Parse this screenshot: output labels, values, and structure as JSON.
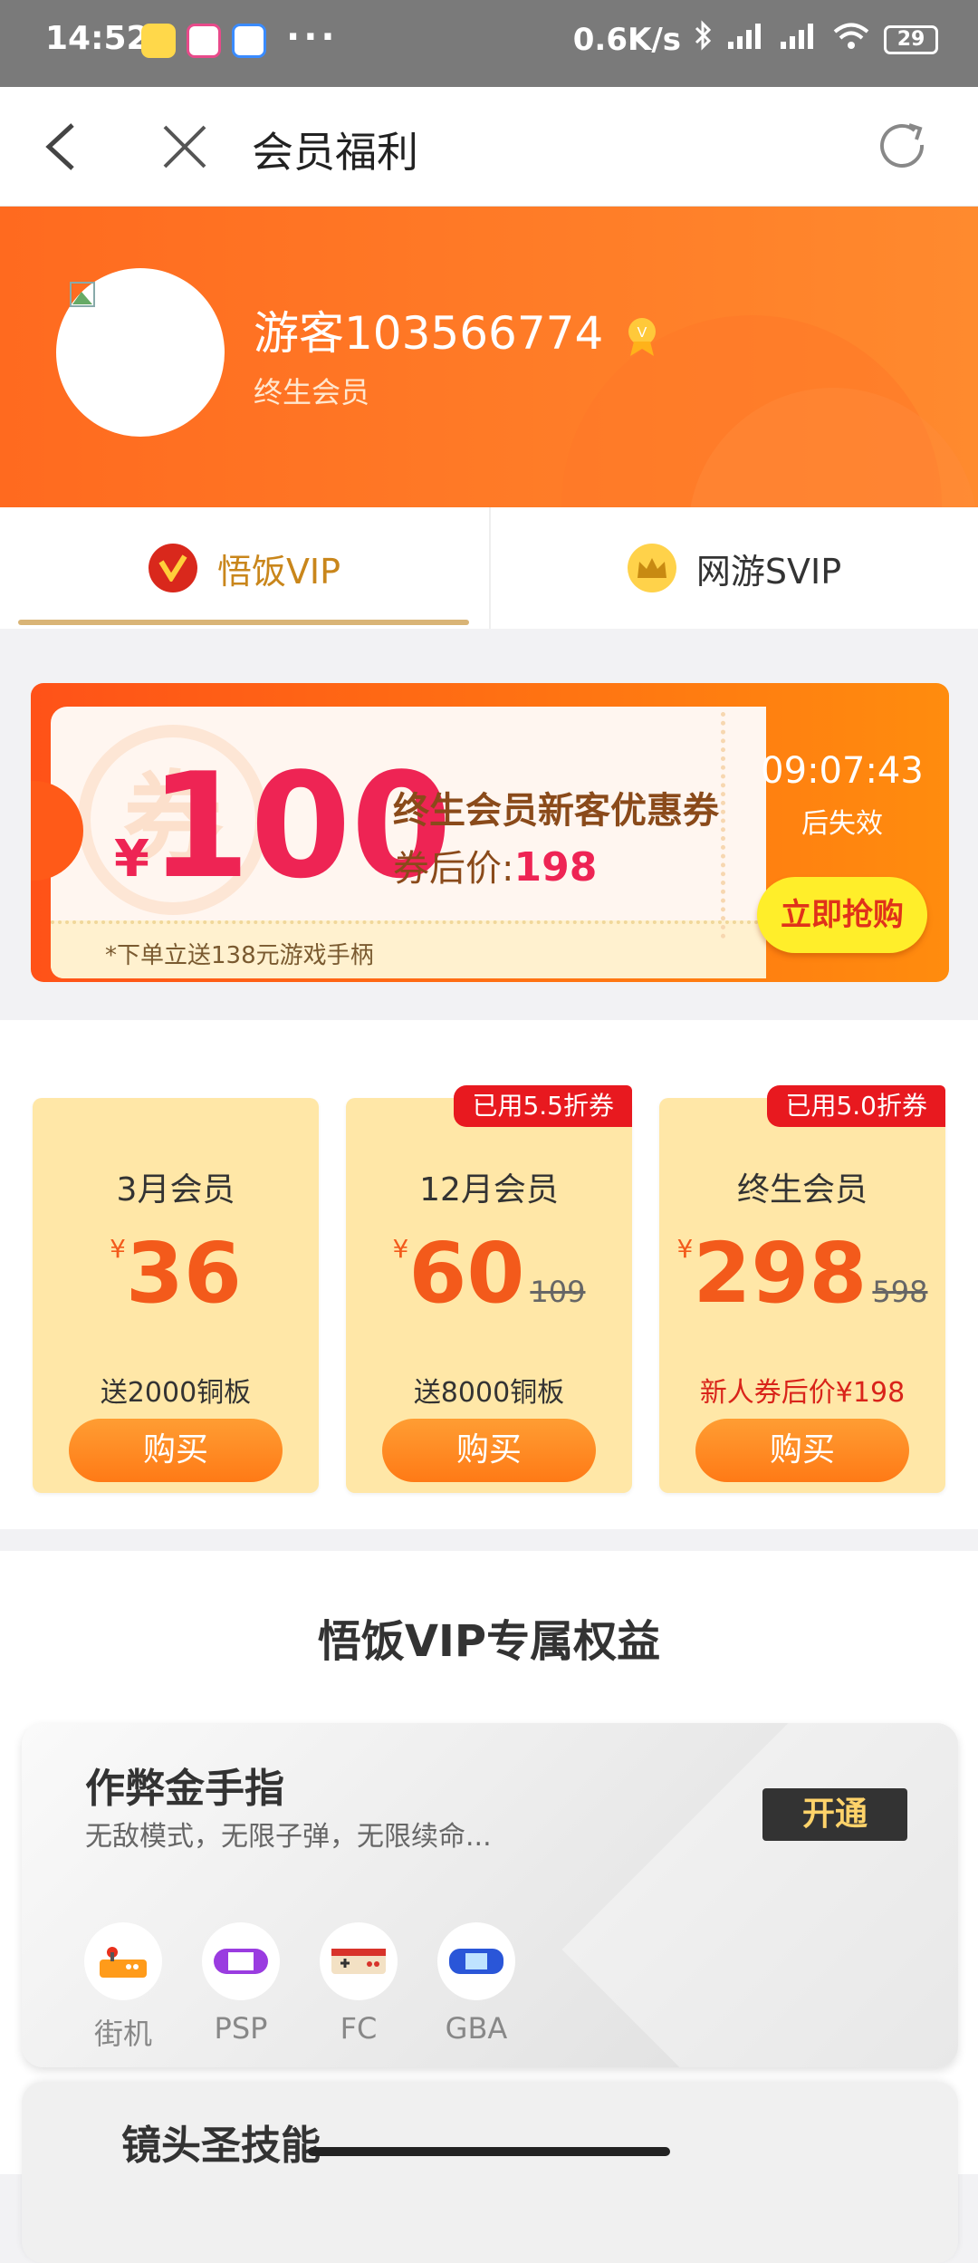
{
  "status_bar": {
    "time": "14:52",
    "more": "···",
    "speed": "0.6K/s",
    "battery": "29"
  },
  "topbar": {
    "title": "会员福利"
  },
  "profile": {
    "username": "游客103566774",
    "level": "终生会员"
  },
  "tabs": [
    {
      "label": "悟饭VIP",
      "active": true
    },
    {
      "label": "网游SVIP",
      "active": false
    }
  ],
  "coupon": {
    "currency": "¥",
    "amount": "100",
    "title": "终生会员新客优惠券",
    "after_price_label": "券后价:",
    "after_price": "198",
    "note": "*下单立送138元游戏手柄",
    "countdown": "09:07:43",
    "expire_label": "后失效",
    "buy_label": "立即抢购",
    "watermark": "券"
  },
  "plans": [
    {
      "name": "3月会员",
      "currency": "¥",
      "price": "36",
      "original": "",
      "gift": "送2000铜板",
      "badge": "",
      "buy": "购买"
    },
    {
      "name": "12月会员",
      "currency": "¥",
      "price": "60",
      "original": "109",
      "gift": "送8000铜板",
      "badge": "已用5.5折券",
      "buy": "购买"
    },
    {
      "name": "终生会员",
      "currency": "¥",
      "price": "298",
      "original": "598",
      "gift": "新人券后价¥198",
      "badge": "已用5.0折券",
      "buy": "购买"
    }
  ],
  "benefits": {
    "title": "悟饭VIP专属权益",
    "card1": {
      "heading": "作弊金手指",
      "desc": "无敌模式，无限子弹，无限续命...",
      "open": "开通",
      "platforms": [
        "街机",
        "PSP",
        "FC",
        "GBA"
      ]
    },
    "card2": {
      "heading": "镜头圣技能"
    }
  },
  "colors": {
    "accent_orange": "#ff6a1f",
    "vip_gold": "#c9861b",
    "price_red": "#f35a1b",
    "badge_red": "#e8191f"
  }
}
